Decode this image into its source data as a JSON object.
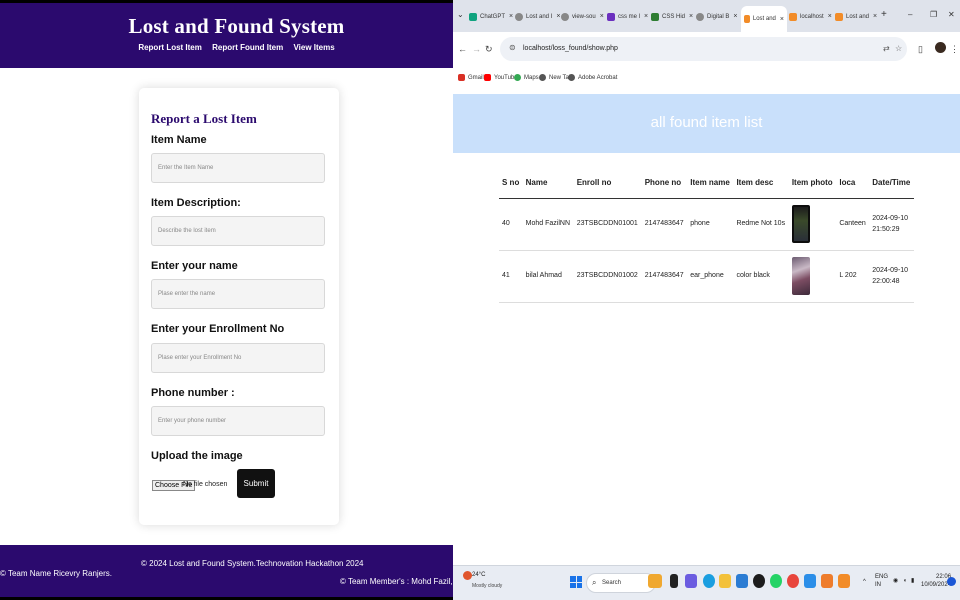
{
  "left": {
    "header": {
      "title": "Lost and Found System",
      "nav": [
        "Report Lost Item",
        "Report Found Item",
        "View Items"
      ]
    },
    "form": {
      "title": "Report a Lost Item",
      "fields": [
        {
          "label": "Item Name",
          "placeholder": "Enter the Item Name"
        },
        {
          "label": "Item Description:",
          "placeholder": "Describe the lost item"
        },
        {
          "label": "Enter your name",
          "placeholder": "Plase enter the name"
        },
        {
          "label": "Enter your Enrollment No",
          "placeholder": "Plase enter your Enrollment No"
        },
        {
          "label": "Phone number :",
          "placeholder": "Enter your phone number"
        }
      ],
      "upload_label": "Upload the image",
      "choose_file": "Choose File",
      "no_file": "No file chosen",
      "submit": "Submit"
    },
    "footer": {
      "copyright": "© 2024 Lost and Found System.Technovation Hackathon 2024",
      "team": "© Team Name Ricevry Ranjers.",
      "members": "© Team Member's : Mohd Fazil, Bila"
    }
  },
  "browser": {
    "tabs": [
      {
        "label": "ChatGPT",
        "color": "#10a37f"
      },
      {
        "label": "Lost and I",
        "color": "#888888"
      },
      {
        "label": "view-sou",
        "color": "#888888"
      },
      {
        "label": "css me l",
        "color": "#6b2fbf"
      },
      {
        "label": "CSS Hid",
        "color": "#2e7d32"
      },
      {
        "label": "Digital B",
        "color": "#888888"
      },
      {
        "label": "Lost and",
        "color": "#f28c28"
      },
      {
        "label": "localhost",
        "color": "#f28c28"
      },
      {
        "label": "Lost and",
        "color": "#f28c28"
      }
    ],
    "url": "localhost/loss_found/show.php",
    "bookmarks": [
      {
        "label": "Gmail",
        "color": "#d93025"
      },
      {
        "label": "YouTube",
        "color": "#ff0000"
      },
      {
        "label": "Maps",
        "color": "#34a853"
      },
      {
        "label": "New Tab",
        "color": "#555555"
      },
      {
        "label": "Adobe Acrobat",
        "color": "#555555"
      }
    ],
    "banner": "all found item list",
    "table": {
      "headers": [
        "S no",
        "Name",
        "Enroll no",
        "Phone no",
        "Item name",
        "Item desc",
        "Item photo",
        "loca",
        "Date/Time"
      ],
      "rows": [
        {
          "sno": "40",
          "name": "Mohd FazilNN",
          "enroll": "23TSBCDDN01001",
          "phone": "2147483647",
          "item": "phone",
          "desc": "Redme Not 10s",
          "loca": "Canteen",
          "date": "2024-09-10",
          "time": "21:50:29"
        },
        {
          "sno": "41",
          "name": "bilal Ahmad",
          "enroll": "23TSBCDDN01002",
          "phone": "2147483647",
          "item": "ear_phone",
          "desc": "color black",
          "loca": "L 202",
          "date": "2024-09-10",
          "time": "22:00:48"
        }
      ]
    },
    "taskbar": {
      "weather_temp": "24°C",
      "weather_desc": "Mostly cloudy",
      "search": "Search",
      "lang": "ENG",
      "region": "IN",
      "time": "22:06",
      "date": "10/09/2024"
    }
  }
}
